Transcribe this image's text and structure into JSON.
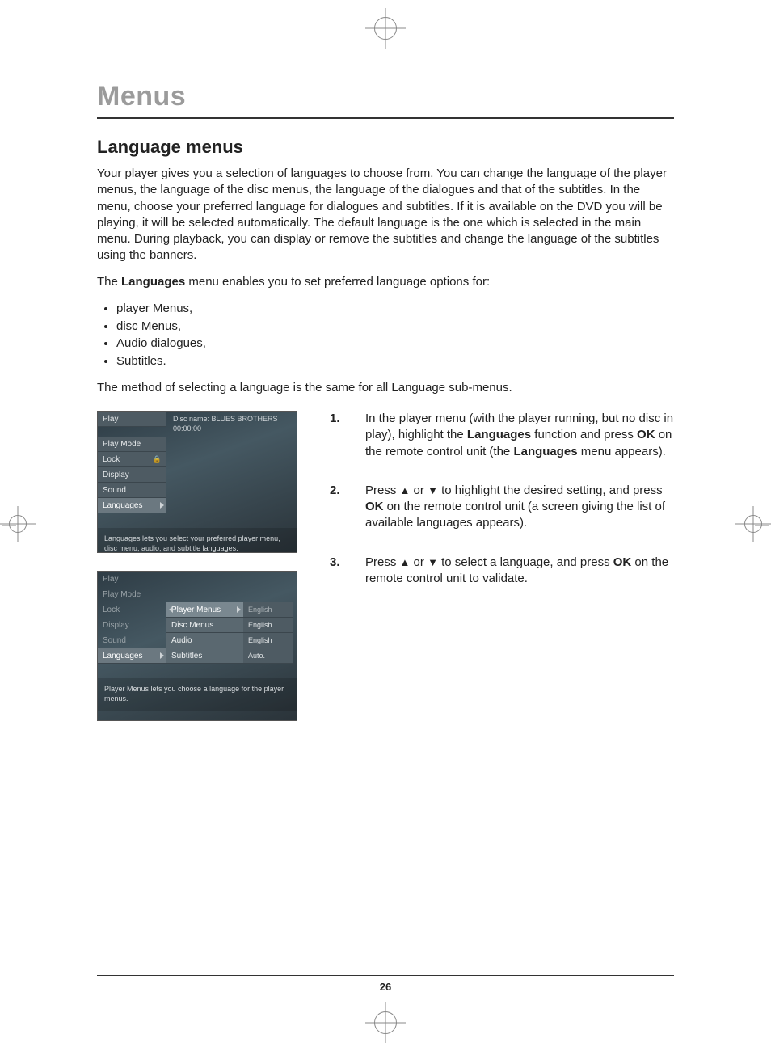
{
  "page": {
    "title": "Menus",
    "section": "Language menus",
    "intro": "Your player gives you a selection of languages to choose from. You can change the language of the player menus, the language of the disc menus, the language of the dialogues and that of the subtitles. In the menu, choose your preferred language for dialogues and subtitles. If it is available on the DVD you will be playing, it will be selected automatically. The default language is the one which is selected in the main menu. During playback, you can display or remove the subtitles and change the language of the subtitles using the banners.",
    "lead_pre": "The ",
    "lead_bold": "Languages",
    "lead_post": " menu enables you to set preferred language options for:",
    "bullets": [
      "player Menus,",
      "disc Menus,",
      "Audio dialogues,",
      "Subtitles."
    ],
    "method_line": "The method of selecting a language is the same for all Language sub-menus.",
    "page_number": "26"
  },
  "steps": [
    {
      "num": "1.",
      "pre": "In the player menu (with the player running, but no disc in play), highlight the ",
      "b1": "Languages",
      "mid1": " function and press ",
      "b2": "OK",
      "mid2": " on the remote control unit (the ",
      "b3": "Languages",
      "post": " menu appears)."
    },
    {
      "num": "2.",
      "pre": "Press ",
      "mid1": " or ",
      "mid2": " to highlight the desired setting, and press ",
      "b1": "OK",
      "post": " on the remote control unit (a screen giving the list of available languages appears)."
    },
    {
      "num": "3.",
      "pre": "Press ",
      "mid1": " or ",
      "mid2": " to select a language, and press ",
      "b1": "OK",
      "post": " on the remote control unit to validate."
    }
  ],
  "fig1": {
    "disc_label": "Disc name: BLUES BROTHERS",
    "time": "00:00:00",
    "menu": [
      "Play",
      "Play Mode",
      "Lock",
      "Display",
      "Sound",
      "Languages"
    ],
    "selected_index": 5,
    "lock_index": 2,
    "caption": "Languages lets you select your preferred player menu, disc menu, audio, and subtitle languages."
  },
  "fig2": {
    "menu": [
      "Play",
      "Play Mode",
      "Lock",
      "Display",
      "Sound",
      "Languages"
    ],
    "selected_index": 5,
    "sub": [
      {
        "label": "Player Menus",
        "value": "English",
        "sel": true
      },
      {
        "label": "Disc Menus",
        "value": "English"
      },
      {
        "label": "Audio",
        "value": "English"
      },
      {
        "label": "Subtitles",
        "value": "Auto."
      }
    ],
    "caption": "Player Menus lets you choose a language for the player menus."
  }
}
